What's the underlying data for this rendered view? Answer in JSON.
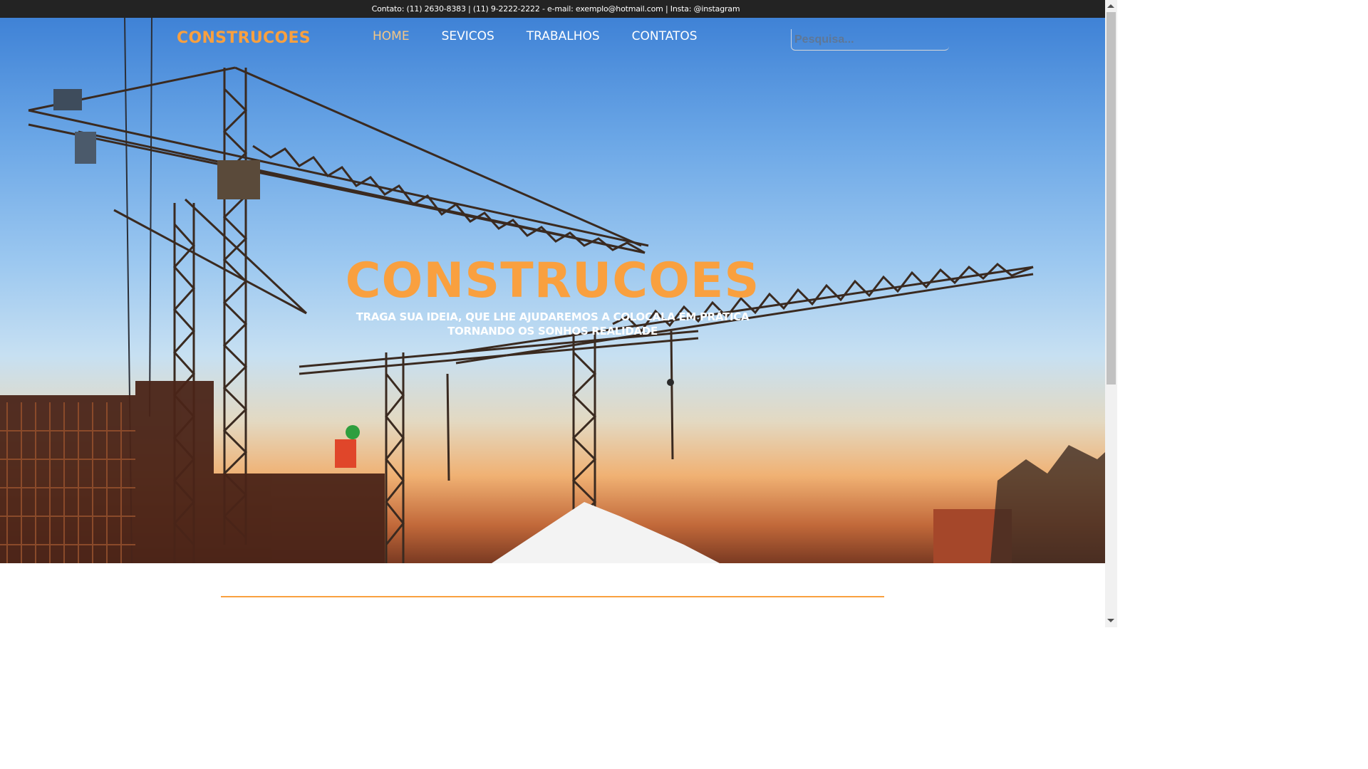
{
  "topbar": {
    "contact_text": "Contato: (11) 2630-8383 | (11) 9-2222-2222 - e-mail: exemplo@hotmail.com | Insta: @instagram"
  },
  "header": {
    "logo": "CONSTRUCOES",
    "nav": [
      {
        "label": "HOME",
        "active": true
      },
      {
        "label": "SEVICOS",
        "active": false
      },
      {
        "label": "TRABALHOS",
        "active": false
      },
      {
        "label": "CONTATOS",
        "active": false
      }
    ],
    "search_placeholder": "Pesquisa..."
  },
  "hero": {
    "title": "CONSTRUCOES",
    "subtitle_line1": "TRAGA SUA IDEIA, QUE LHE AJUDAREMOS A COLOCALA EM PRÁTICA",
    "subtitle_line2": "TORNANDO OS SONHOS REALIDADE",
    "background": "construction-cranes-at-sunset-photo"
  },
  "colors": {
    "accent": "#f9a03f",
    "topbar_bg": "#232323",
    "nav_active": "#f6c784",
    "text_light": "#ffffff"
  }
}
